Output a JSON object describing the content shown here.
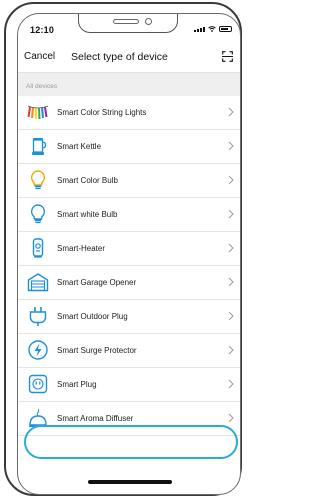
{
  "status": {
    "time": "12:10"
  },
  "nav": {
    "cancel_label": "Cancel",
    "title": "Select type of device"
  },
  "section": {
    "label": "All devices"
  },
  "devices": [
    {
      "label": "Smart Color String Lights",
      "icon": "string-lights-icon"
    },
    {
      "label": "Smart Kettle",
      "icon": "kettle-icon"
    },
    {
      "label": "Smart Color Bulb",
      "icon": "color-bulb-icon"
    },
    {
      "label": "Smart white Bulb",
      "icon": "white-bulb-icon"
    },
    {
      "label": "Smart-Heater",
      "icon": "heater-icon"
    },
    {
      "label": "Smart Garage Opener",
      "icon": "garage-icon"
    },
    {
      "label": "Smart Outdoor Plug",
      "icon": "outdoor-plug-icon"
    },
    {
      "label": "Smart Surge Protector",
      "icon": "surge-protector-icon"
    },
    {
      "label": "Smart Plug",
      "icon": "plug-icon"
    },
    {
      "label": "Smart Aroma Diffuser",
      "icon": "aroma-diffuser-icon"
    }
  ],
  "colors": {
    "accent": "#1d8fe0",
    "highlight_ring": "#2aa9dd",
    "section_bg": "#efefef"
  }
}
